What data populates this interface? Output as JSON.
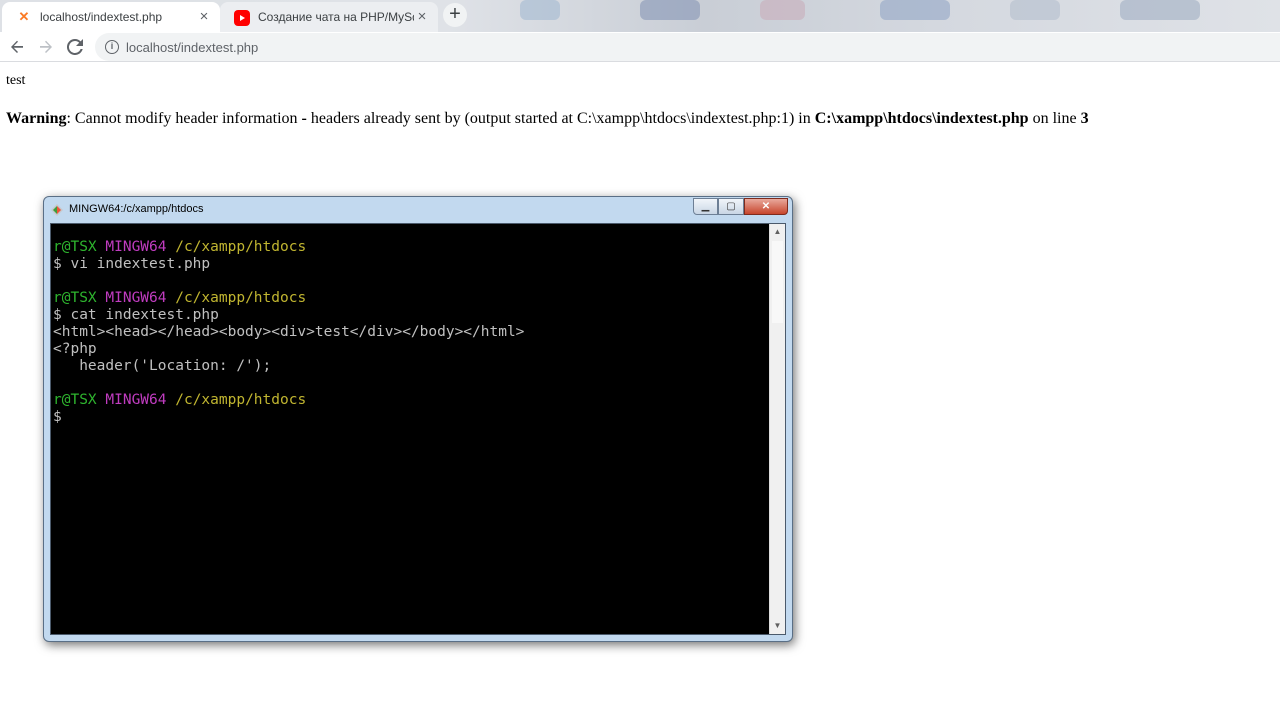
{
  "browser": {
    "tabs": [
      {
        "title": "localhost/indextest.php",
        "favicon": "xampp-icon",
        "active": true
      },
      {
        "title": "Создание чата на PHP/MySql/Aj",
        "favicon": "youtube-icon",
        "active": false
      }
    ],
    "new_tab_label": "+",
    "close_label": "×",
    "url": "localhost/indextest.php"
  },
  "page": {
    "text": "test",
    "warning": {
      "label": "Warning",
      "message_1": ": Cannot modify header information ",
      "dash": "-",
      "message_2": " headers already sent by (output started at C:\\xampp\\htdocs\\indextest.php:1) in ",
      "file": "C:\\xampp\\htdocs\\indextest.php",
      "on_line": " on line ",
      "line": "3"
    }
  },
  "terminal": {
    "title": "MINGW64:/c/xampp/htdocs",
    "prompt_user": "r@TSX",
    "prompt_host": "MINGW64",
    "prompt_path": "/c/xampp/htdocs",
    "cmd_1": "$ vi indextest.php",
    "cmd_2": "$ cat indextest.php",
    "out_1": "<html><head></head><body><div>test</div></body></html>",
    "out_2": "<?php",
    "out_3": "   header('Location: /');",
    "cmd_3": "$",
    "colors": {
      "user": "#2eb52e",
      "host": "#c03cc0",
      "path": "#c0b530"
    }
  }
}
